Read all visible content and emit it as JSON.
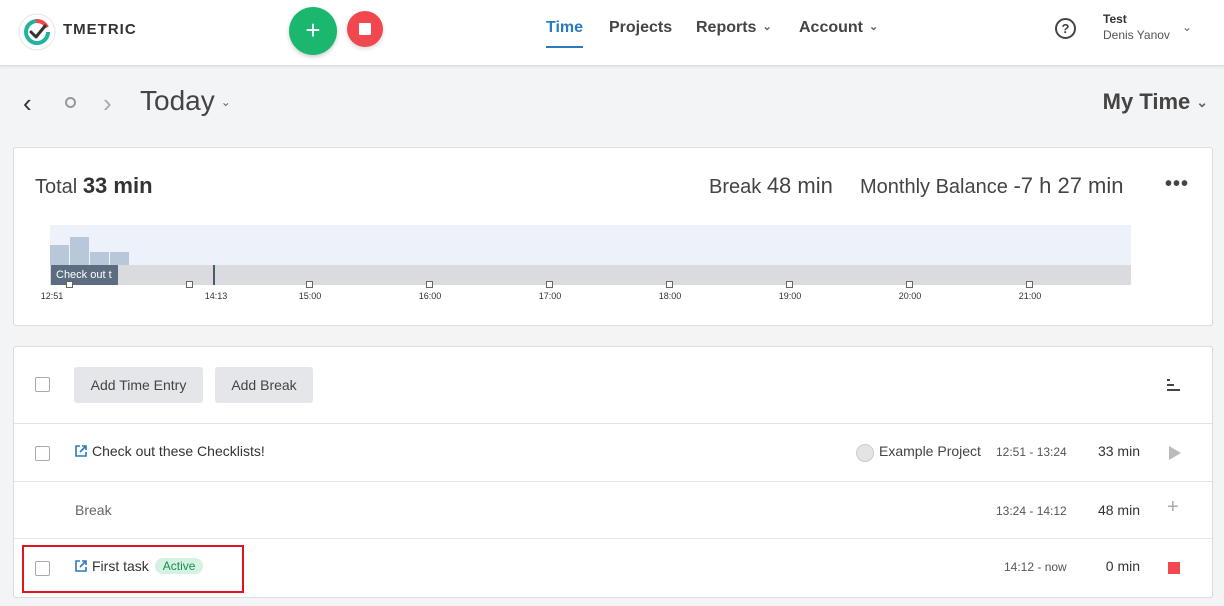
{
  "header": {
    "logo_text": "TMETRIC",
    "nav": [
      {
        "label": "Time"
      },
      {
        "label": "Projects"
      },
      {
        "label": "Reports"
      },
      {
        "label": "Account"
      }
    ],
    "help_label": "?",
    "user": {
      "org": "Test",
      "name": "Denis Yanov"
    }
  },
  "datebar": {
    "title": "Today",
    "view": "My Time"
  },
  "summary": {
    "total_label": "Total",
    "total_value": "33 min",
    "break_label": "Break",
    "break_value": "48 min",
    "balance_label": "Monthly Balance",
    "balance_value": "-7 h 27 min",
    "more_label": "•••"
  },
  "timeline": {
    "entry_label": "Check out t",
    "start_label": "12:51",
    "now_label": "14:13",
    "hours": [
      "15:00",
      "16:00",
      "17:00",
      "18:00",
      "19:00",
      "20:00",
      "21:00"
    ]
  },
  "toolbar": {
    "add_time_entry": "Add Time Entry",
    "add_break": "Add Break"
  },
  "entries": [
    {
      "task": "Check out these Checklists!",
      "project": "Example Project",
      "range": "12:51 - 13:24",
      "duration": "33 min"
    },
    {
      "task": "Break",
      "range": "13:24 - 14:12",
      "duration": "48 min"
    },
    {
      "task": "First task",
      "badge": "Active",
      "range": "14:12 - now",
      "duration": "0 min"
    }
  ],
  "colors": {
    "accent": "#2a7abf",
    "start_green": "#1bb76e",
    "stop_red": "#f0484e",
    "active_badge": "#d4f2e2",
    "highlight": "#e0141e"
  },
  "icons": [
    "tmetric-logo-icon",
    "plus-icon",
    "stop-icon",
    "chevron-left-icon",
    "circle-icon",
    "chevron-right-icon",
    "chevron-down-icon",
    "help-icon",
    "more-icon",
    "sort-icon",
    "external-link-icon",
    "project-icon",
    "play-icon"
  ]
}
